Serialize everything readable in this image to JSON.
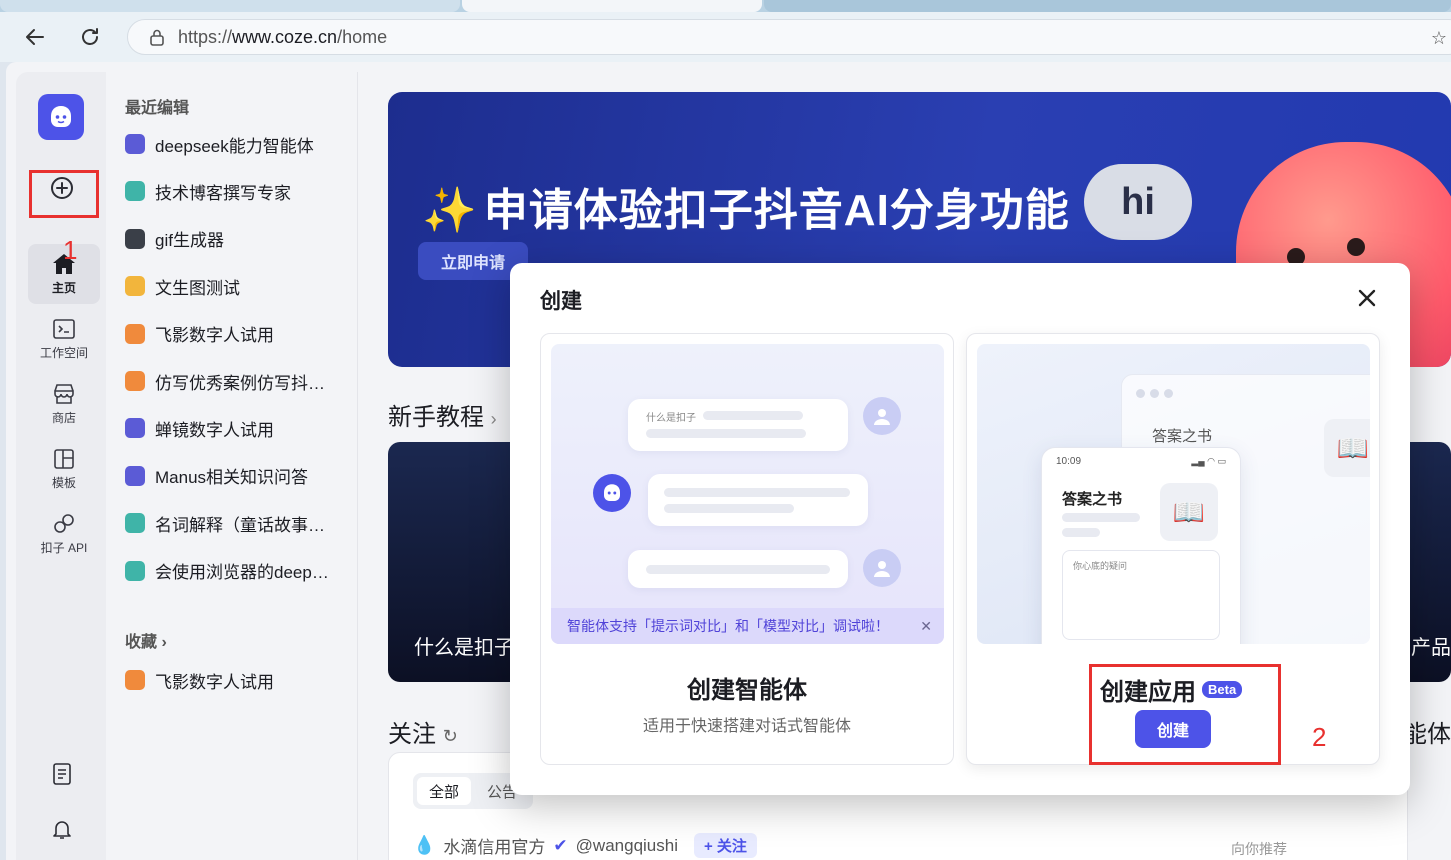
{
  "browser": {
    "url_prefix": "https://",
    "url_host": "www.coze.cn",
    "url_path": "/home"
  },
  "rail": {
    "items": [
      {
        "label": "主页",
        "icon": "home-icon",
        "active": true
      },
      {
        "label": "工作空间",
        "icon": "terminal-icon"
      },
      {
        "label": "商店",
        "icon": "store-icon"
      },
      {
        "label": "模板",
        "icon": "template-icon"
      },
      {
        "label": "扣子 API",
        "icon": "api-icon"
      }
    ]
  },
  "annotations": {
    "label_1": "1",
    "label_2": "2"
  },
  "recent": {
    "title": "最近编辑",
    "items": [
      {
        "label": "deepseek能力智能体",
        "color": "#5b5bd6"
      },
      {
        "label": "技术博客撰写专家",
        "color": "#3fb4a8"
      },
      {
        "label": "gif生成器",
        "color": "#3a3f48"
      },
      {
        "label": "文生图测试",
        "color": "#f2b53c"
      },
      {
        "label": "飞影数字人试用",
        "color": "#f08a3c"
      },
      {
        "label": "仿写优秀案例仿写抖…",
        "color": "#f08a3c"
      },
      {
        "label": "蝉镜数字人试用",
        "color": "#5b5bd6"
      },
      {
        "label": "Manus相关知识问答",
        "color": "#5b5bd6"
      },
      {
        "label": "名词解释（童话故事…",
        "color": "#3fb4a8"
      },
      {
        "label": "会使用浏览器的deep…",
        "color": "#3fb4a8"
      }
    ],
    "favorites_title": "收藏 ›",
    "favorites": [
      {
        "label": "飞影数字人试用",
        "color": "#f08a3c"
      }
    ]
  },
  "main": {
    "banner_title": "申请体验扣子抖音AI分身功能",
    "banner_button": "立即申请",
    "hi_text": "hi",
    "tutorial_title": "新手教程",
    "tutorial_caption": "什么是扣子",
    "tutorial_caption_right": "产品",
    "follow_title": "关注",
    "right_heading": "能体",
    "tabs": [
      "全部",
      "公告"
    ],
    "follow_user": "水滴信用官方",
    "follow_handle": "@wangqiushi",
    "follow_button": "+ 关注",
    "recommend": "向你推荐"
  },
  "modal": {
    "title": "创建",
    "agent": {
      "title": "创建智能体",
      "desc": "适用于快速搭建对话式智能体",
      "preview_question": "什么是扣子",
      "notice": "智能体支持「提示词对比」和「模型对比」调试啦！"
    },
    "app": {
      "title": "创建应用",
      "badge": "Beta",
      "button": "创建",
      "preview_time": "10:09",
      "preview_title": "答案之书",
      "preview_input": "你心底的疑问"
    }
  }
}
